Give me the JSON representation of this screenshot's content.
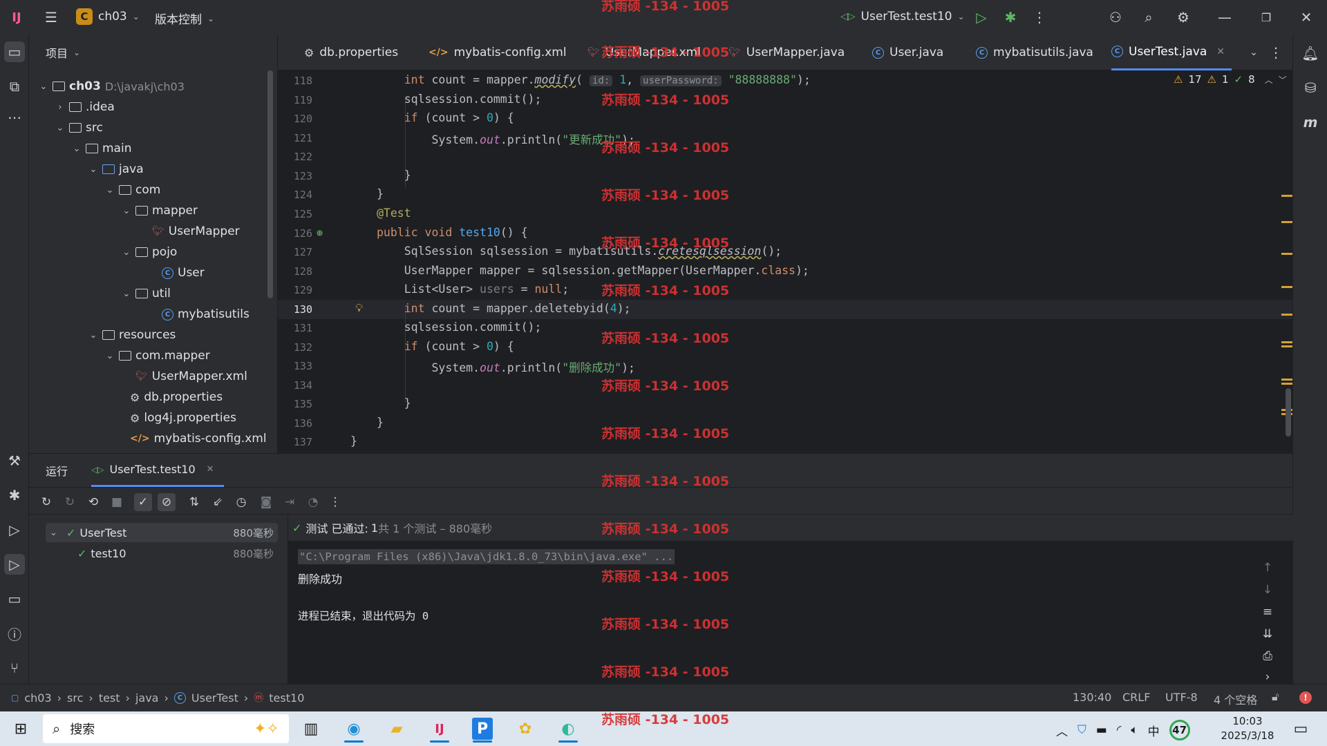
{
  "titlebar": {
    "project_badge": "C",
    "project_name": "ch03",
    "vcs_label": "版本控制",
    "run_config": "UserTest.test10"
  },
  "project_panel": {
    "title": "项目",
    "root_name": "ch03",
    "root_path": "D:\\javakj\\ch03",
    "items": [
      {
        "label": "ch03"
      },
      {
        "label": ".idea"
      },
      {
        "label": "src"
      },
      {
        "label": "main"
      },
      {
        "label": "java"
      },
      {
        "label": "com"
      },
      {
        "label": "mapper"
      },
      {
        "label": "UserMapper"
      },
      {
        "label": "pojo"
      },
      {
        "label": "User"
      },
      {
        "label": "util"
      },
      {
        "label": "mybatisutils"
      },
      {
        "label": "resources"
      },
      {
        "label": "com.mapper"
      },
      {
        "label": "UserMapper.xml"
      },
      {
        "label": "db.properties"
      },
      {
        "label": "log4j.properties"
      },
      {
        "label": "mybatis-config.xml"
      }
    ]
  },
  "tabs": [
    {
      "label": "db.properties",
      "icon": "gear-icon"
    },
    {
      "label": "mybatis-config.xml",
      "icon": "xml-icon"
    },
    {
      "label": "UserMapper.xml",
      "icon": "mybatis-icon"
    },
    {
      "label": "UserMapper.java",
      "icon": "mybatis-icon"
    },
    {
      "label": "User.java",
      "icon": "class-icon"
    },
    {
      "label": "mybatisutils.java",
      "icon": "class-icon"
    },
    {
      "label": "UserTest.java",
      "icon": "class-icon",
      "active": true
    }
  ],
  "inspections": {
    "warnings": "17",
    "weak_warnings": "1",
    "ok": "8"
  },
  "editor": {
    "line_numbers": [
      "118",
      "119",
      "120",
      "121",
      "122",
      "123",
      "124",
      "125",
      "126",
      "127",
      "128",
      "129",
      "130",
      "131",
      "132",
      "133",
      "134",
      "135",
      "136",
      "137"
    ],
    "current_line": "130",
    "hint_id": "id:",
    "hint_password": "userPassword:",
    "str_pwd": "\"88888888\"",
    "str_update": "\"更新成功\"",
    "str_delete": "\"删除成功\""
  },
  "run_panel": {
    "tab_run": "运行",
    "tab_config": "UserTest.test10",
    "tree": [
      {
        "label": "UserTest",
        "time": "880毫秒"
      },
      {
        "label": "test10",
        "time": "880毫秒"
      }
    ],
    "status_prefix": "测试 已通过:",
    "status_count": "1",
    "status_suffix": "共 1 个测试 – 880毫秒",
    "console_cmd": "\"C:\\Program Files (x86)\\Java\\jdk1.8.0_73\\bin\\java.exe\" ...",
    "console_out": "删除成功",
    "console_exit": "进程已结束，退出代码为 0"
  },
  "statusbar": {
    "breadcrumb": [
      "ch03",
      "src",
      "test",
      "java",
      "UserTest",
      "test10"
    ],
    "position": "130:40",
    "line_sep": "CRLF",
    "encoding": "UTF-8",
    "indent": "4 个空格"
  },
  "taskbar": {
    "search_placeholder": "搜索",
    "ime": "中",
    "badge": "47",
    "time": "10:03",
    "date": "2025/3/18"
  },
  "watermark": "苏雨硕 -134 - 1005"
}
